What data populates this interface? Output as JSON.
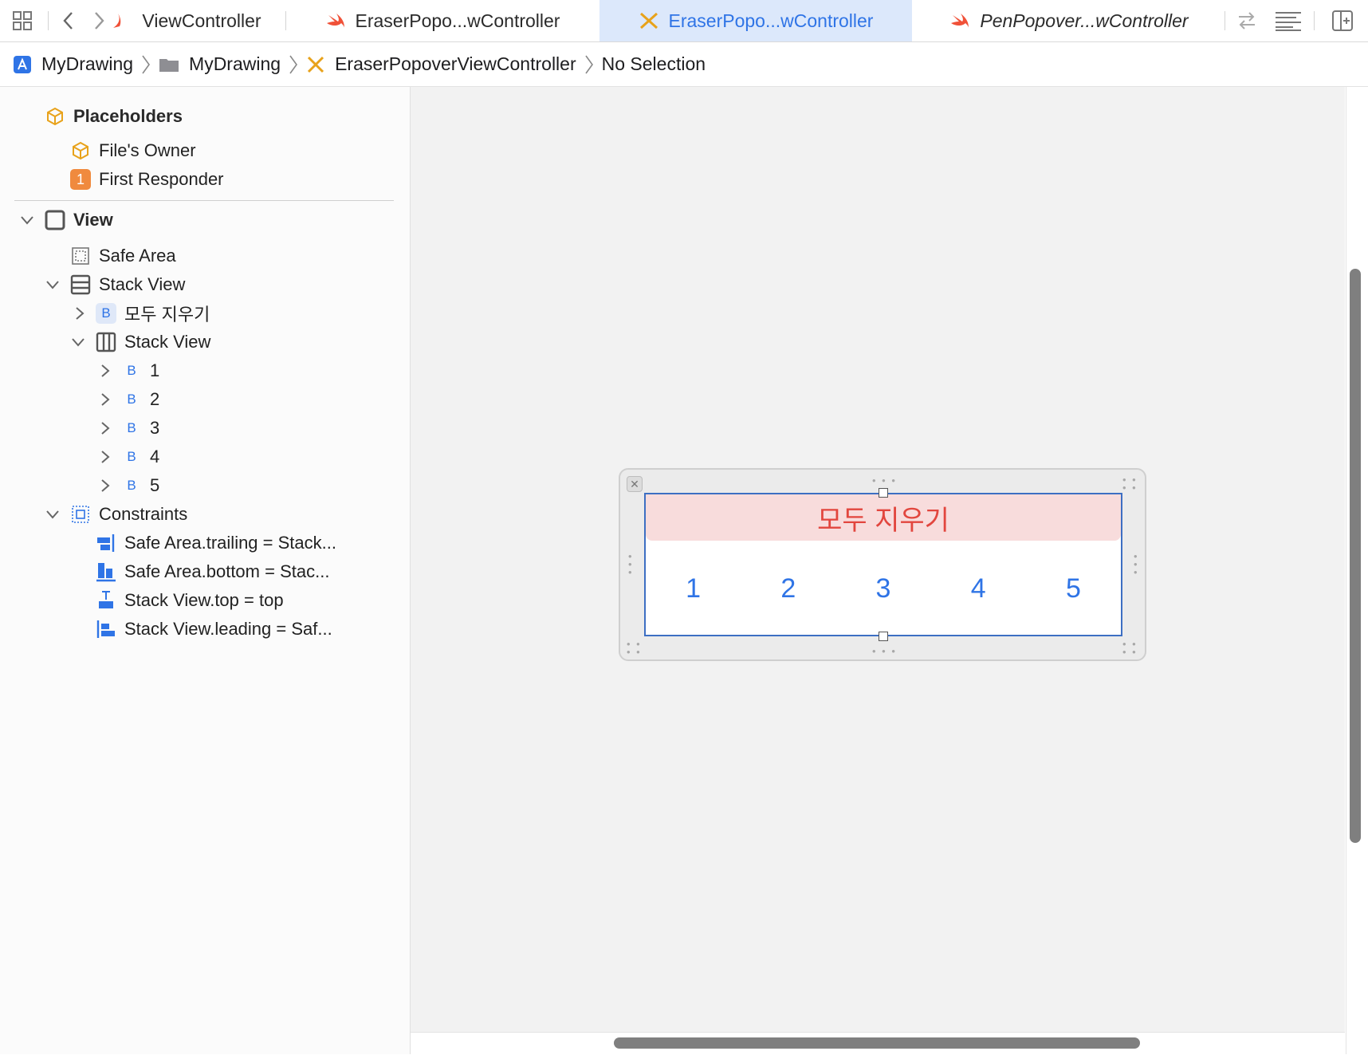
{
  "tabs": [
    {
      "label": "ViewController",
      "kind": "swift",
      "active": false
    },
    {
      "label": "EraserPopo...wController",
      "kind": "swift",
      "active": false
    },
    {
      "label": "EraserPopo...wController",
      "kind": "interface-builder",
      "active": true
    },
    {
      "label": "PenPopover...wController",
      "kind": "swift",
      "active": false
    }
  ],
  "breadcrumb": {
    "project": "MyDrawing",
    "folder": "MyDrawing",
    "file": "EraserPopoverViewController",
    "selection": "No Selection"
  },
  "outline": {
    "placeholders_label": "Placeholders",
    "files_owner": "File's Owner",
    "first_responder_badge": "1",
    "first_responder": "First Responder",
    "view_label": "View",
    "safe_area": "Safe Area",
    "stack_view_outer": "Stack View",
    "erase_all_badge": "B",
    "erase_all": "모두 지우기",
    "stack_view_inner": "Stack View",
    "buttons": [
      {
        "badge": "B",
        "label": "1"
      },
      {
        "badge": "B",
        "label": "2"
      },
      {
        "badge": "B",
        "label": "3"
      },
      {
        "badge": "B",
        "label": "4"
      },
      {
        "badge": "B",
        "label": "5"
      }
    ],
    "constraints_label": "Constraints",
    "constraints": [
      "Safe Area.trailing = Stack...",
      "Safe Area.bottom = Stac...",
      "Stack View.top = top",
      "Stack View.leading = Saf..."
    ]
  },
  "canvas": {
    "erase_all_button": "모두 지우기",
    "number_buttons": [
      "1",
      "2",
      "3",
      "4",
      "5"
    ]
  },
  "colors": {
    "accent": "#2f74e6",
    "destructive": "#e2463e",
    "destructive_bg": "#f8dcdc",
    "active_tab_bg": "#dce8fb"
  }
}
